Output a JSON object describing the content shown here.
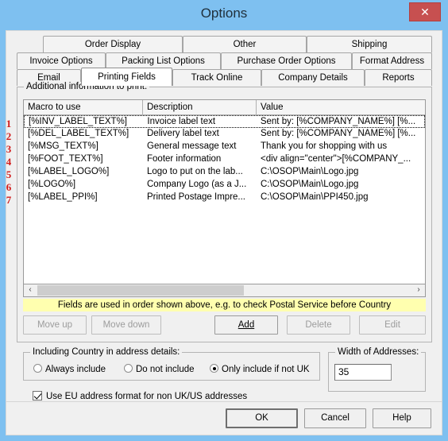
{
  "window": {
    "title": "Options",
    "close_glyph": "✕",
    "frame_color": "#7EC0F0",
    "close_color": "#c75050"
  },
  "tabs": {
    "row1": [
      {
        "label": "Order Display",
        "active": false
      },
      {
        "label": "Other",
        "active": false
      },
      {
        "label": "Shipping",
        "active": false
      }
    ],
    "row2": [
      {
        "label": "Invoice Options",
        "active": false
      },
      {
        "label": "Packing List Options",
        "active": false
      },
      {
        "label": "Purchase Order Options",
        "active": false
      },
      {
        "label": "Format Address",
        "active": false
      }
    ],
    "row3": [
      {
        "label": "Email",
        "active": false
      },
      {
        "label": "Printing Fields",
        "active": true
      },
      {
        "label": "Track Online",
        "active": false
      },
      {
        "label": "Company Details",
        "active": false
      },
      {
        "label": "Reports",
        "active": false
      }
    ]
  },
  "group_additional": {
    "label": "Additional information to print:",
    "columns": [
      "Macro to use",
      "Description",
      "Value"
    ],
    "rows": [
      {
        "num": "1",
        "macro": "[%INV_LABEL_TEXT%]",
        "description": "Invoice label text",
        "value": "Sent by: [%COMPANY_NAME%] [%..."
      },
      {
        "num": "2",
        "macro": "[%DEL_LABEL_TEXT%]",
        "description": "Delivery label text",
        "value": "Sent by: [%COMPANY_NAME%] [%..."
      },
      {
        "num": "3",
        "macro": "[%MSG_TEXT%]",
        "description": "General message text",
        "value": "Thank you for shopping with us"
      },
      {
        "num": "4",
        "macro": "[%FOOT_TEXT%]",
        "description": "Footer information",
        "value": "<div align=\"center\">[%COMPANY_..."
      },
      {
        "num": "5",
        "macro": "[%LABEL_LOGO%]",
        "description": "Logo to put on the lab...",
        "value": "C:\\OSOP\\Main\\Logo.jpg"
      },
      {
        "num": "6",
        "macro": "[%LOGO%]",
        "description": "Company Logo (as a J...",
        "value": "C:\\OSOP\\Main\\Logo.jpg"
      },
      {
        "num": "7",
        "macro": "[%LABEL_PPI%]",
        "description": "Printed Postage Impre...",
        "value": "C:\\OSOP\\Main\\PPI450.jpg"
      }
    ],
    "scrollbar": {
      "left_arrow": "‹",
      "right_arrow": "›"
    },
    "hint": "Fields are used in order shown above, e.g. to check Postal Service before Country",
    "hint_color": "#ffffaf",
    "buttons": {
      "move_up": {
        "label": "Move up",
        "accel": "u",
        "enabled": false
      },
      "move_down": {
        "label": "Move down",
        "accel": "d",
        "enabled": false
      },
      "add": {
        "label": "Add",
        "accel": "A",
        "enabled": true
      },
      "delete": {
        "label": "Delete",
        "accel": "D",
        "enabled": false
      },
      "edit": {
        "label": "Edit",
        "accel": "E",
        "enabled": false
      }
    }
  },
  "group_country": {
    "label": "Including Country in address details:",
    "options": [
      {
        "label": "Always include",
        "selected": false
      },
      {
        "label": "Do not include",
        "selected": false
      },
      {
        "label": "Only include if not UK",
        "selected": true
      }
    ]
  },
  "group_width": {
    "label": "Width of Addresses:",
    "value": "35"
  },
  "eu_checkbox": {
    "label": "Use EU address format for non UK/US addresses",
    "checked": true
  },
  "dialog_buttons": {
    "ok": "OK",
    "cancel": "Cancel",
    "help": "Help"
  },
  "annotations": {
    "color": "#d01a1a",
    "numbers": [
      "1",
      "2",
      "3",
      "4",
      "5",
      "6",
      "7"
    ]
  }
}
